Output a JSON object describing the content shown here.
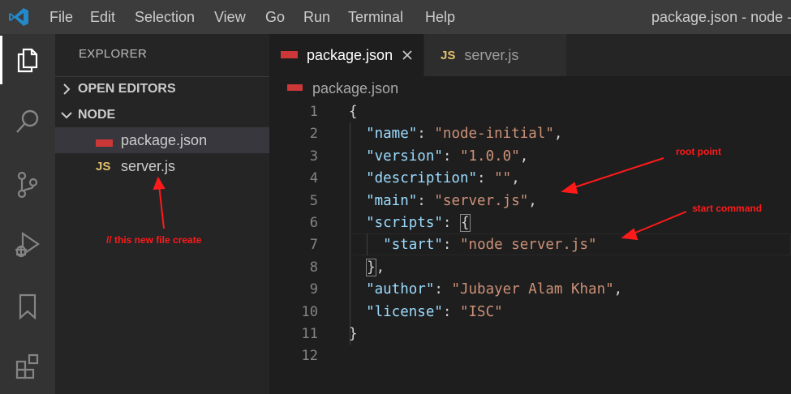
{
  "titlebar": {
    "menu": [
      "File",
      "Edit",
      "Selection",
      "View",
      "Go",
      "Run",
      "Terminal",
      "Help"
    ],
    "window_title": "package.json - node - V"
  },
  "activitybar": {
    "icons": [
      "files-icon",
      "search-icon",
      "source-control-icon",
      "run-debug-icon",
      "bookmarks-icon",
      "extensions-icon"
    ]
  },
  "sidebar": {
    "title": "EXPLORER",
    "open_editors_label": "OPEN EDITORS",
    "folder_label": "NODE",
    "files": [
      {
        "icon": "npm-icon",
        "name": "package.json"
      },
      {
        "icon_text": "JS",
        "name": "server.js"
      }
    ]
  },
  "tabs": [
    {
      "label": "package.json",
      "icon": "npm-icon"
    },
    {
      "label": "server.js",
      "icon_text": "JS"
    }
  ],
  "breadcrumb": {
    "label": "package.json"
  },
  "editor": {
    "line_numbers": [
      "1",
      "2",
      "3",
      "4",
      "5",
      "6",
      "7",
      "8",
      "9",
      "10",
      "11",
      "12"
    ],
    "lines": [
      [
        {
          "t": "p",
          "v": "{"
        }
      ],
      [
        {
          "t": "p",
          "v": "  "
        },
        {
          "t": "k",
          "v": "\"name\""
        },
        {
          "t": "p",
          "v": ": "
        },
        {
          "t": "s",
          "v": "\"node-initial\""
        },
        {
          "t": "p",
          "v": ","
        }
      ],
      [
        {
          "t": "p",
          "v": "  "
        },
        {
          "t": "k",
          "v": "\"version\""
        },
        {
          "t": "p",
          "v": ": "
        },
        {
          "t": "s",
          "v": "\"1.0.0\""
        },
        {
          "t": "p",
          "v": ","
        }
      ],
      [
        {
          "t": "p",
          "v": "  "
        },
        {
          "t": "k",
          "v": "\"description\""
        },
        {
          "t": "p",
          "v": ": "
        },
        {
          "t": "s",
          "v": "\"\""
        },
        {
          "t": "p",
          "v": ","
        }
      ],
      [
        {
          "t": "p",
          "v": "  "
        },
        {
          "t": "k",
          "v": "\"main\""
        },
        {
          "t": "p",
          "v": ": "
        },
        {
          "t": "s",
          "v": "\"server.js\""
        },
        {
          "t": "p",
          "v": ","
        }
      ],
      [
        {
          "t": "p",
          "v": "  "
        },
        {
          "t": "k",
          "v": "\"scripts\""
        },
        {
          "t": "p",
          "v": ": "
        },
        {
          "t": "b",
          "v": "{"
        }
      ],
      [
        {
          "t": "p",
          "v": "    "
        },
        {
          "t": "k",
          "v": "\"start\""
        },
        {
          "t": "p",
          "v": ": "
        },
        {
          "t": "s",
          "v": "\"node server.js\""
        }
      ],
      [
        {
          "t": "p",
          "v": "  "
        },
        {
          "t": "b",
          "v": "}"
        },
        {
          "t": "p",
          "v": ","
        }
      ],
      [
        {
          "t": "p",
          "v": "  "
        },
        {
          "t": "k",
          "v": "\"author\""
        },
        {
          "t": "p",
          "v": ": "
        },
        {
          "t": "s",
          "v": "\"Jubayer Alam Khan\""
        },
        {
          "t": "p",
          "v": ","
        }
      ],
      [
        {
          "t": "p",
          "v": "  "
        },
        {
          "t": "k",
          "v": "\"license\""
        },
        {
          "t": "p",
          "v": ": "
        },
        {
          "t": "s",
          "v": "\"ISC\""
        }
      ],
      [
        {
          "t": "p",
          "v": "}"
        }
      ],
      []
    ]
  },
  "annotations": {
    "root_point": "root point",
    "start_command": "start command",
    "new_file": "// this new file create"
  },
  "colors": {
    "annotation": "#ff1a1a",
    "json_key": "#9cdcfe",
    "json_string": "#ce9178",
    "npm_badge": "#cb3837",
    "js_badge": "#e2c06a",
    "vscode_logo": "#2489ca"
  }
}
